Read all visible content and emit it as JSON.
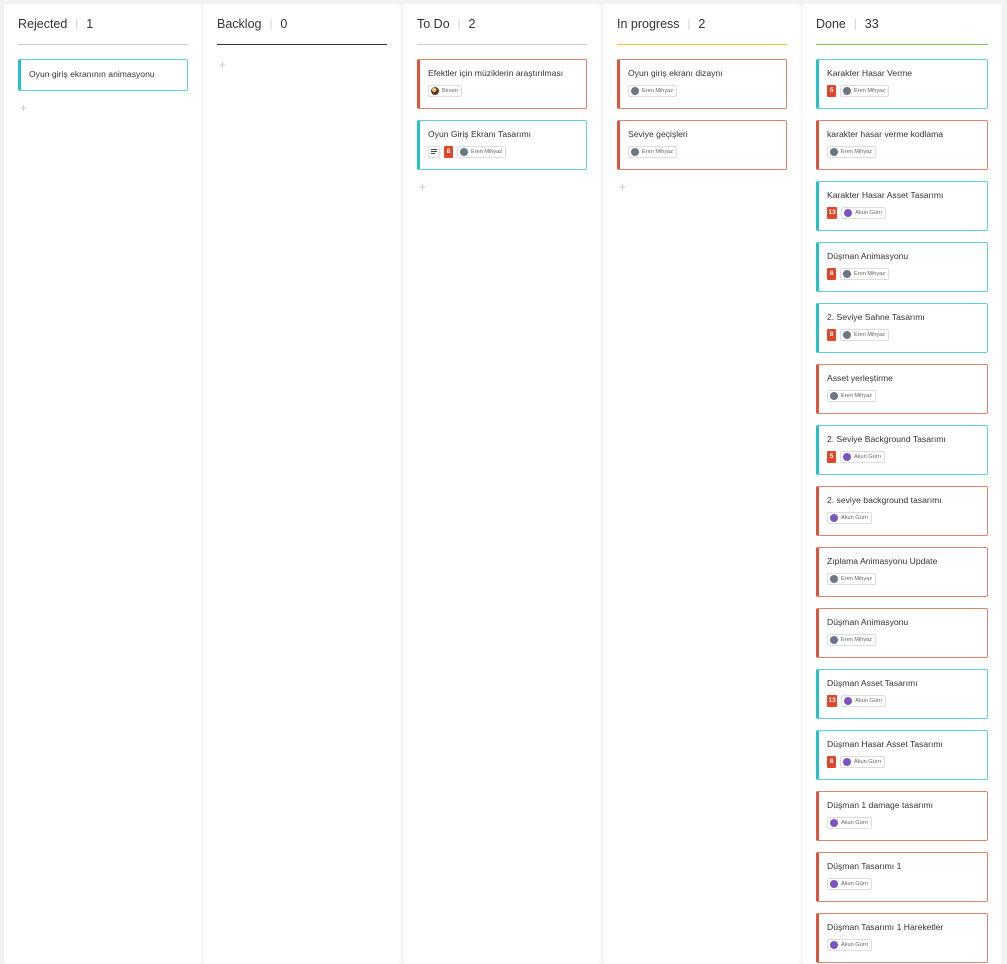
{
  "columns": [
    {
      "title": "Rejected",
      "count": "1",
      "accent": "#cccccc",
      "cards": [
        {
          "type": "story",
          "title": "Oyun giriş ekranının animasyonu",
          "single": true
        }
      ],
      "add_label": "+"
    },
    {
      "title": "Backlog",
      "count": "0",
      "accent": "#333333",
      "cards": [],
      "add_label": "+"
    },
    {
      "title": "To Do",
      "count": "2",
      "accent": "#cccccc",
      "cards": [
        {
          "type": "task",
          "title": "Efektler için müziklerin araştırılması",
          "assignee": "Birsen",
          "avatar": "photo"
        },
        {
          "type": "story",
          "title": "Oyun Giriş Ekranı Tasarımı",
          "has_desc": true,
          "points": "8",
          "assignee": "Eren Mihyaz",
          "avatar": "gray"
        }
      ],
      "add_label": "+"
    },
    {
      "title": "In progress",
      "count": "2",
      "accent": "#f0c419",
      "cards": [
        {
          "type": "task",
          "title": "Oyun giriş ekranı dizaynı",
          "assignee": "Eren Mihyaz",
          "avatar": "gray"
        },
        {
          "type": "task",
          "title": "Seviye geçişleri",
          "assignee": "Eren Mihyaz",
          "avatar": "gray"
        }
      ],
      "add_label": "+"
    },
    {
      "title": "Done",
      "count": "33",
      "accent": "#8bc34a",
      "cards": [
        {
          "type": "story",
          "title": "Karakter Hasar Verme",
          "points": "5",
          "assignee": "Eren Mihyaz",
          "avatar": "gray"
        },
        {
          "type": "task",
          "title": "karakter hasar verme kodlama",
          "assignee": "Eren Mihyaz",
          "avatar": "gray"
        },
        {
          "type": "story",
          "title": "Karakter Hasar Asset Tasarımı",
          "points": "13",
          "assignee": "Akun Gürrı",
          "avatar": "purple"
        },
        {
          "type": "story",
          "title": "Düşman Animasyonu",
          "points": "8",
          "assignee": "Eren Mihyaz",
          "avatar": "gray"
        },
        {
          "type": "story",
          "title": "2. Seviye Sahne Tasarımı",
          "points": "8",
          "assignee": "Eren Mihyaz",
          "avatar": "gray"
        },
        {
          "type": "task",
          "title": "Asset yerleştirme",
          "assignee": "Eren Mihyaz",
          "avatar": "gray"
        },
        {
          "type": "story",
          "title": "2. Seviye Background Tasarımı",
          "points": "5",
          "assignee": "Akun Gürrı",
          "avatar": "purple"
        },
        {
          "type": "task",
          "title": "2. seviye background tasarımı",
          "assignee": "Akun Gürrı",
          "avatar": "purple"
        },
        {
          "type": "task",
          "title": "Zıplama Animasyonu Update",
          "assignee": "Eren Mihyaz",
          "avatar": "gray"
        },
        {
          "type": "task",
          "title": "Düşman Animasyonu",
          "assignee": "Eren Mihyaz",
          "avatar": "gray"
        },
        {
          "type": "story",
          "title": "Düşman Asset Tasarımı",
          "points": "13",
          "assignee": "Akun Gürrı",
          "avatar": "purple"
        },
        {
          "type": "story",
          "title": "Düşman Hasar Asset Tasarımı",
          "points": "8",
          "assignee": "Akun Gürrı",
          "avatar": "purple"
        },
        {
          "type": "task",
          "title": "Düşman 1 damage tasarımı",
          "assignee": "Akun Gürrı",
          "avatar": "purple"
        },
        {
          "type": "task",
          "title": "Düşman Tasarımı 1",
          "assignee": "Akun Gürrı",
          "avatar": "purple"
        },
        {
          "type": "task",
          "title": "Düşman Tasarımı 1 Hareketler",
          "assignee": "Akun Gürrı",
          "avatar": "purple"
        }
      ]
    }
  ]
}
